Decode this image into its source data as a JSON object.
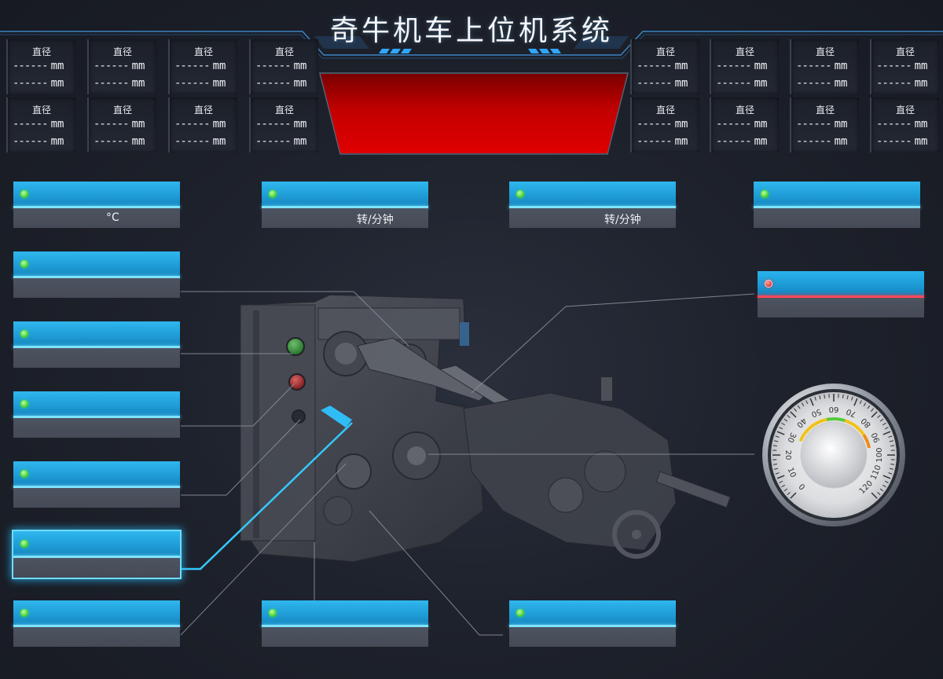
{
  "header": {
    "title": "奇牛机车上位机系统"
  },
  "diameter_readouts": [
    {
      "label": "直径",
      "line1": "------",
      "line2": "------",
      "unit": "mm"
    },
    {
      "label": "直径",
      "line1": "------",
      "line2": "------",
      "unit": "mm"
    },
    {
      "label": "直径",
      "line1": "------",
      "line2": "------",
      "unit": "mm"
    },
    {
      "label": "直径",
      "line1": "------",
      "line2": "------",
      "unit": "mm"
    },
    {
      "label": "直径",
      "line1": "------",
      "line2": "------",
      "unit": "mm"
    },
    {
      "label": "直径",
      "line1": "------",
      "line2": "------",
      "unit": "mm"
    },
    {
      "label": "直径",
      "line1": "------",
      "line2": "------",
      "unit": "mm"
    },
    {
      "label": "直径",
      "line1": "------",
      "line2": "------",
      "unit": "mm"
    },
    {
      "label": "直径",
      "line1": "------",
      "line2": "------",
      "unit": "mm"
    },
    {
      "label": "直径",
      "line1": "------",
      "line2": "------",
      "unit": "mm"
    },
    {
      "label": "直径",
      "line1": "------",
      "line2": "------",
      "unit": "mm"
    },
    {
      "label": "直径",
      "line1": "------",
      "line2": "------",
      "unit": "mm"
    },
    {
      "label": "直径",
      "line1": "------",
      "line2": "------",
      "unit": "mm"
    },
    {
      "label": "直径",
      "line1": "------",
      "line2": "------",
      "unit": "mm"
    },
    {
      "label": "直径",
      "line1": "------",
      "line2": "------",
      "unit": "mm"
    },
    {
      "label": "直径",
      "line1": "------",
      "line2": "------",
      "unit": "mm"
    }
  ],
  "panels": {
    "temperature": {
      "unit": "°C",
      "status": "normal"
    },
    "speed_1": {
      "unit": "转/分钟",
      "status": "normal"
    },
    "speed_2": {
      "unit": "转/分钟",
      "status": "normal"
    },
    "panel_top_right": {
      "unit": "",
      "status": "normal"
    },
    "panel_alarm": {
      "unit": "",
      "status": "alarm"
    },
    "panel_left_2": {
      "unit": "",
      "status": "normal"
    },
    "panel_left_3": {
      "unit": "",
      "status": "normal"
    },
    "panel_left_4": {
      "unit": "",
      "status": "normal"
    },
    "panel_left_5": {
      "unit": "",
      "status": "normal"
    },
    "panel_left_6": {
      "unit": "",
      "status": "selected"
    },
    "panel_bottom_1": {
      "unit": "",
      "status": "normal"
    },
    "panel_bottom_2": {
      "unit": "",
      "status": "normal"
    },
    "panel_bottom_3": {
      "unit": "",
      "status": "normal"
    }
  },
  "gauge": {
    "min": 0,
    "max": 120,
    "major_step": 10,
    "ticks": [
      "0",
      "10",
      "20",
      "30",
      "40",
      "50",
      "60",
      "70",
      "80",
      "90",
      "100",
      "110",
      "120"
    ],
    "colors": {
      "yellow": "#f3c21a",
      "green": "#57c93a",
      "orange": "#f08a1c"
    }
  },
  "colors": {
    "panel_blue": "#1f9cd6",
    "panel_glow": "#7fe3ff",
    "alarm_red": "#e00000",
    "status_green": "#4fd33a",
    "status_red": "#e83a3a"
  }
}
